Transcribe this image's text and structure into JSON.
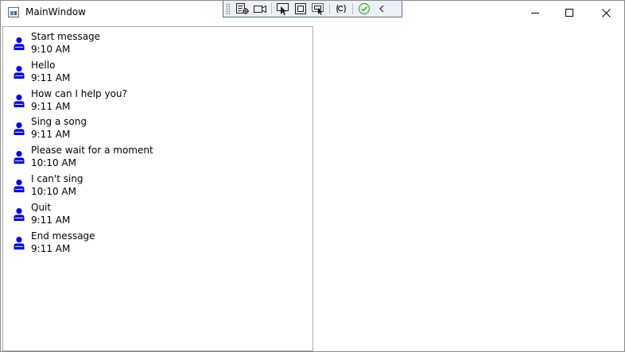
{
  "window": {
    "title": "MainWindow",
    "controls": [
      "minimize-icon",
      "maximize-icon",
      "close-icon"
    ]
  },
  "debug_toolbar": {
    "icons": [
      "toolbar-grip-icon",
      "live-visual-tree-icon",
      "video-record-icon",
      "select-element-icon",
      "display-adorners-icon",
      "track-focus-icon",
      "hot-reload-icon",
      "status-ok-icon",
      "collapse-chevron-icon"
    ]
  },
  "messages": [
    {
      "text": "Start message",
      "time": "9:10 AM"
    },
    {
      "text": "Hello",
      "time": "9:11 AM"
    },
    {
      "text": "How can I help you?",
      "time": "9:11 AM"
    },
    {
      "text": "Sing a song",
      "time": "9:11 AM"
    },
    {
      "text": "Please wait for a moment",
      "time": "10:10 AM"
    },
    {
      "text": "I can't sing",
      "time": "10:10 AM"
    },
    {
      "text": "Quit",
      "time": "9:11 AM"
    },
    {
      "text": "End message",
      "time": "9:11 AM"
    }
  ],
  "colors": {
    "person_icon": "#0000e6",
    "status_ok": "#3faa3f",
    "toolbar_bg": "#eef0f7"
  }
}
